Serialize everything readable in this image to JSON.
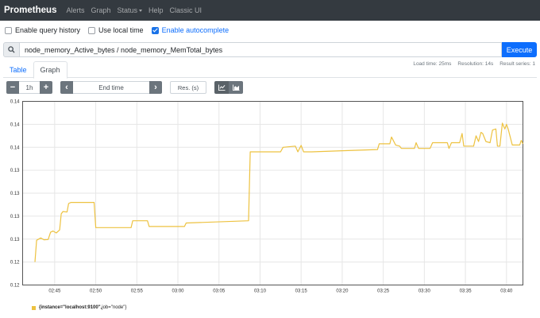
{
  "navbar": {
    "brand": "Prometheus",
    "links": [
      "Alerts",
      "Graph",
      "Status",
      "Help",
      "Classic UI"
    ]
  },
  "options": {
    "query_history": {
      "label": "Enable query history",
      "checked": false
    },
    "local_time": {
      "label": "Use local time",
      "checked": false
    },
    "autocomplete": {
      "label": "Enable autocomplete",
      "checked": true
    }
  },
  "query": {
    "expression": "node_memory_Active_bytes / node_memory_MemTotal_bytes",
    "execute_label": "Execute",
    "search_icon": "search-icon"
  },
  "stats": {
    "load_time": "Load time: 25ms",
    "resolution": "Resolution: 14s",
    "result_series": "Result series: 1"
  },
  "tabs": {
    "table": "Table",
    "graph": "Graph",
    "active": "Graph"
  },
  "controls": {
    "range_minus": "−",
    "range": "1h",
    "range_plus": "+",
    "prev": "‹",
    "end_time": "End time",
    "next": "›",
    "resolution_placeholder": "Res. (s)",
    "line_icon": "line-chart-icon",
    "stacked_icon": "stacked-chart-icon"
  },
  "chart_data": {
    "type": "line",
    "y_ticks": [
      "0.14",
      "0.14",
      "0.14",
      "0.13",
      "0.13",
      "0.13",
      "0.13",
      "0.12",
      "0.12"
    ],
    "x_ticks": [
      "02:45",
      "02:50",
      "02:55",
      "03:00",
      "03:05",
      "03:10",
      "03:15",
      "03:20",
      "03:25",
      "03:30",
      "03:35",
      "03:40"
    ],
    "x_tick_minutes": [
      45,
      50,
      55,
      60,
      65,
      70,
      75,
      80,
      85,
      90,
      95,
      100
    ],
    "xlim": [
      41.1,
      102
    ],
    "ylim": [
      0,
      8
    ],
    "grid": true,
    "color": "#EDC240",
    "series": [
      {
        "name": "{instance=\"localhost:9100\", job=\"node\"}",
        "points": [
          [
            42.6,
            1.0
          ],
          [
            42.8,
            1.95
          ],
          [
            43.3,
            2.05
          ],
          [
            43.7,
            1.97
          ],
          [
            44.2,
            1.98
          ],
          [
            44.5,
            2.3
          ],
          [
            44.8,
            2.35
          ],
          [
            45.2,
            2.27
          ],
          [
            45.6,
            2.4
          ],
          [
            45.8,
            3.1
          ],
          [
            46.0,
            3.2
          ],
          [
            46.5,
            3.18
          ],
          [
            46.7,
            3.55
          ],
          [
            47.0,
            3.6
          ],
          [
            49.8,
            3.6
          ],
          [
            50.0,
            2.5
          ],
          [
            54.3,
            2.5
          ],
          [
            54.5,
            2.8
          ],
          [
            56.3,
            2.8
          ],
          [
            56.5,
            2.55
          ],
          [
            60.8,
            2.55
          ],
          [
            61.0,
            2.7
          ],
          [
            68.6,
            2.8
          ],
          [
            68.8,
            5.8
          ],
          [
            72.5,
            5.8
          ],
          [
            72.8,
            6.0
          ],
          [
            74.3,
            6.05
          ],
          [
            74.6,
            5.8
          ],
          [
            75.0,
            6.08
          ],
          [
            75.3,
            5.8
          ],
          [
            76.3,
            5.8
          ],
          [
            80.0,
            5.85
          ],
          [
            84.3,
            5.9
          ],
          [
            84.5,
            6.15
          ],
          [
            85.8,
            6.15
          ],
          [
            86.0,
            6.45
          ],
          [
            86.5,
            6.1
          ],
          [
            87.0,
            6.05
          ],
          [
            87.2,
            5.95
          ],
          [
            88.8,
            5.95
          ],
          [
            89.0,
            6.2
          ],
          [
            89.3,
            5.95
          ],
          [
            90.7,
            5.95
          ],
          [
            91.0,
            6.2
          ],
          [
            92.8,
            6.2
          ],
          [
            93.0,
            5.95
          ],
          [
            93.3,
            6.2
          ],
          [
            94.3,
            6.2
          ],
          [
            94.6,
            6.6
          ],
          [
            94.8,
            6.05
          ],
          [
            96.0,
            6.05
          ],
          [
            96.3,
            6.5
          ],
          [
            96.6,
            6.25
          ],
          [
            96.9,
            6.65
          ],
          [
            97.1,
            6.6
          ],
          [
            97.5,
            6.25
          ],
          [
            98.0,
            6.2
          ],
          [
            98.3,
            6.75
          ],
          [
            98.7,
            6.8
          ],
          [
            98.9,
            6.05
          ],
          [
            99.2,
            6.05
          ],
          [
            99.5,
            7.05
          ],
          [
            99.8,
            6.8
          ],
          [
            100.0,
            7.0
          ],
          [
            100.2,
            6.8
          ],
          [
            100.7,
            6.1
          ],
          [
            101.6,
            6.1
          ],
          [
            101.8,
            6.3
          ],
          [
            102.0,
            6.15
          ]
        ]
      }
    ]
  },
  "legend": {
    "instance_part": "{instance=\"localhost:9100\",",
    "job_part": " job=\"node\"}"
  }
}
